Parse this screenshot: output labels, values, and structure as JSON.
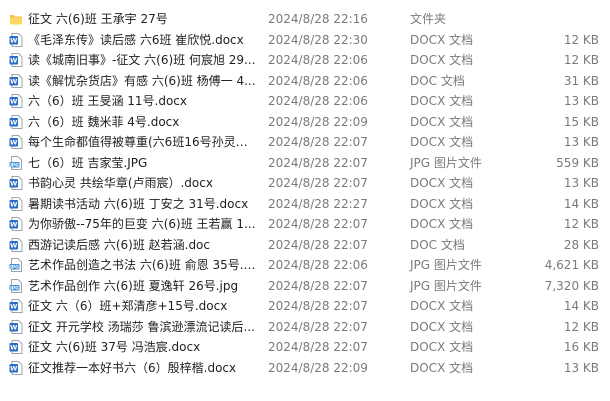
{
  "files": [
    {
      "icon": "folder-icon",
      "name": "征文 六(6)班 王承宇 27号",
      "date": "2024/8/28 22:16",
      "type": "文件夹",
      "size": ""
    },
    {
      "icon": "word-document-icon",
      "name": "《毛泽东传》读后感 六6班 崔欣悦.docx",
      "date": "2024/8/28 22:30",
      "type": "DOCX 文档",
      "size": "12 KB"
    },
    {
      "icon": "word-document-icon",
      "name": "读《城南旧事》-征文 六(6)班 何宸旭 29...",
      "date": "2024/8/28 22:06",
      "type": "DOCX 文档",
      "size": "12 KB"
    },
    {
      "icon": "word-document-icon",
      "name": "读《解忧杂货店》有感 六(6)班 杨傅一 4...",
      "date": "2024/8/28 22:06",
      "type": "DOC 文档",
      "size": "31 KB"
    },
    {
      "icon": "word-document-icon",
      "name": "六（6）班 王旻涵 11号.docx",
      "date": "2024/8/28 22:06",
      "type": "DOCX 文档",
      "size": "13 KB"
    },
    {
      "icon": "word-document-icon",
      "name": "六（6）班  魏米菲 4号.docx",
      "date": "2024/8/28 22:09",
      "type": "DOCX 文档",
      "size": "15 KB"
    },
    {
      "icon": "word-document-icon",
      "name": "每个生命都值得被尊重(六6班16号孙灵浩...",
      "date": "2024/8/28 22:07",
      "type": "DOCX 文档",
      "size": "13 KB"
    },
    {
      "icon": "jpg-image-icon",
      "name": "七（6）班 吉家莹.JPG",
      "date": "2024/8/28 22:07",
      "type": "JPG 图片文件",
      "size": "559 KB"
    },
    {
      "icon": "word-document-icon",
      "name": "书韵心灵 共绘华章(卢雨宸）.docx",
      "date": "2024/8/28 22:07",
      "type": "DOCX 文档",
      "size": "13 KB"
    },
    {
      "icon": "word-document-icon",
      "name": "暑期读书活动 六(6)班 丁安之 31号.docx",
      "date": "2024/8/28 22:27",
      "type": "DOCX 文档",
      "size": "14 KB"
    },
    {
      "icon": "word-document-icon",
      "name": "为你骄傲--75年的巨变 六(6)班 王若赢 1...",
      "date": "2024/8/28 22:07",
      "type": "DOCX 文档",
      "size": "12 KB"
    },
    {
      "icon": "word-document-icon",
      "name": "西游记读后感 六(6)班 赵若涵.doc",
      "date": "2024/8/28 22:07",
      "type": "DOC 文档",
      "size": "28 KB"
    },
    {
      "icon": "jpg-image-icon",
      "name": "艺术作品创造之书法 六(6)班 俞恩 35号.j...",
      "date": "2024/8/28 22:06",
      "type": "JPG 图片文件",
      "size": "4,621 KB"
    },
    {
      "icon": "jpg-image-icon",
      "name": "艺术作品创作 六(6)班 夏逸轩 26号.jpg",
      "date": "2024/8/28 22:07",
      "type": "JPG 图片文件",
      "size": "7,320 KB"
    },
    {
      "icon": "word-document-icon",
      "name": "征文 六（6）班+郑清彦+15号.docx",
      "date": "2024/8/28 22:07",
      "type": "DOCX 文档",
      "size": "14 KB"
    },
    {
      "icon": "word-document-icon",
      "name": "征文 开元学校 汤瑞莎 鲁滨逊漂流记读后...",
      "date": "2024/8/28 22:07",
      "type": "DOCX 文档",
      "size": "12 KB"
    },
    {
      "icon": "word-document-icon",
      "name": "征文 六(6)班 37号 冯浩宸.docx",
      "date": "2024/8/28 22:07",
      "type": "DOCX 文档",
      "size": "16 KB"
    },
    {
      "icon": "word-document-icon",
      "name": "征文推荐一本好书六（6）殷梓楷.docx",
      "date": "2024/8/28 22:09",
      "type": "DOCX 文档",
      "size": "13 KB"
    }
  ],
  "colors": {
    "folder": "#f5c542",
    "word": "#2b6cc4",
    "jpg": "#3f8fd6",
    "secondary_text": "#7a7a7a"
  }
}
